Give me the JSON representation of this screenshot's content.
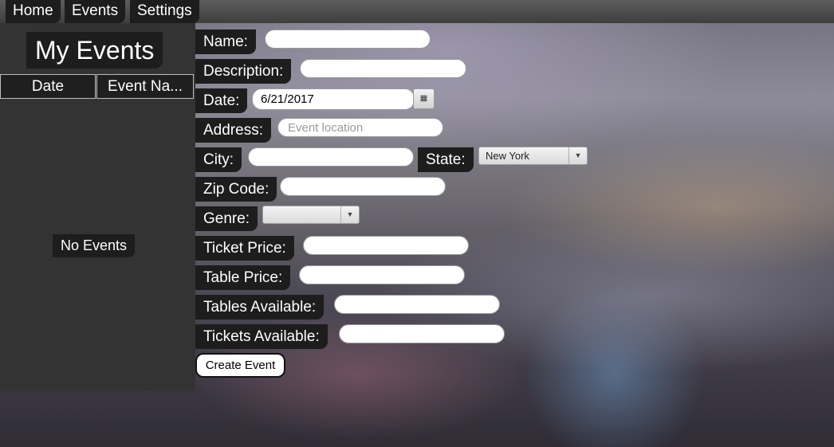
{
  "nav": {
    "home": "Home",
    "events": "Events",
    "settings": "Settings"
  },
  "sidebar": {
    "title": "My Events",
    "columns": [
      "Date",
      "Event Na..."
    ],
    "empty_text": "No Events"
  },
  "form": {
    "name_label": "Name:",
    "description_label": "Description:",
    "date_label": "Date:",
    "date_value": "6/21/2017",
    "address_label": "Address:",
    "address_placeholder": "Event location",
    "city_label": "City:",
    "state_label": "State:",
    "state_value": "New York",
    "zip_label": "Zip Code:",
    "genre_label": "Genre:",
    "genre_value": "",
    "ticket_price_label": "Ticket Price:",
    "table_price_label": "Table Price:",
    "tables_available_label": "Tables Available:",
    "tickets_available_label": "Tickets Available:",
    "create_button": "Create Event"
  }
}
